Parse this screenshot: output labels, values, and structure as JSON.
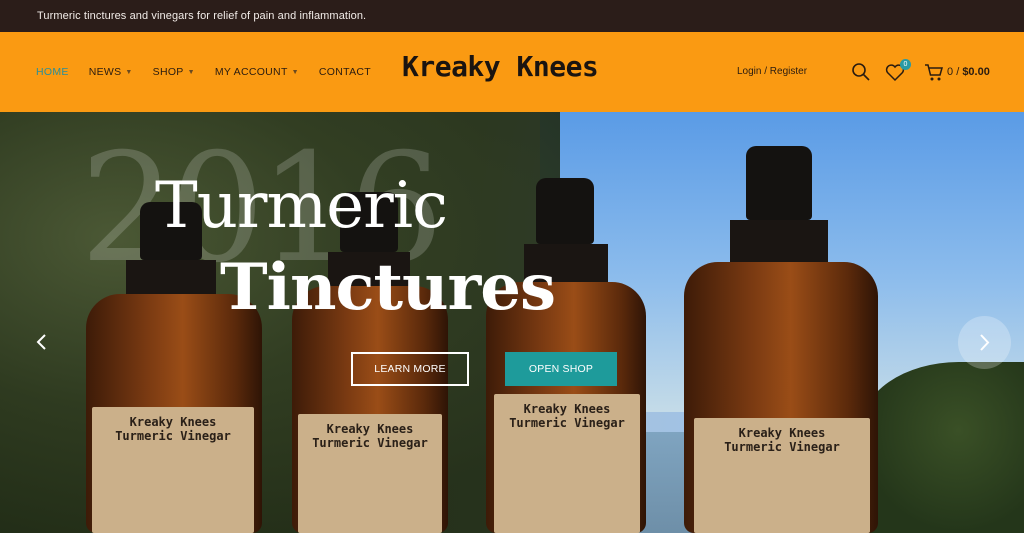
{
  "topbar": {
    "text": "Turmeric tinctures and vinegars for relief of pain and inflammation."
  },
  "nav": {
    "items": [
      {
        "label": "HOME"
      },
      {
        "label": "NEWS"
      },
      {
        "label": "SHOP"
      },
      {
        "label": "MY ACCOUNT"
      },
      {
        "label": "CONTACT"
      }
    ]
  },
  "logo": {
    "text": "Kreaky Knees"
  },
  "header_right": {
    "login": "Login / Register",
    "wishlist_count": "0",
    "cart_count": "0",
    "cart_separator": "/",
    "cart_total": "$0.00"
  },
  "hero": {
    "year": "2016",
    "title_line1": "Turmeric",
    "title_line2": "Tinctures",
    "learn_more": "LEARN MORE",
    "open_shop": "OPEN SHOP"
  },
  "bottles": [
    {
      "line1": "Kreaky Knees",
      "line2": "Turmeric Vinegar"
    },
    {
      "line1": "Kreaky Knees",
      "line2": "Turmeric Vinegar"
    },
    {
      "line1": "Kreaky Knees",
      "line2": "Turmeric Vinegar"
    },
    {
      "line1": "Kreaky Knees",
      "line2": "Turmeric Vinegar"
    }
  ],
  "colors": {
    "topbar": "#2b1d19",
    "header": "#fa9a12",
    "active_nav": "#2a8f9a",
    "accent": "#1e9b9b"
  }
}
